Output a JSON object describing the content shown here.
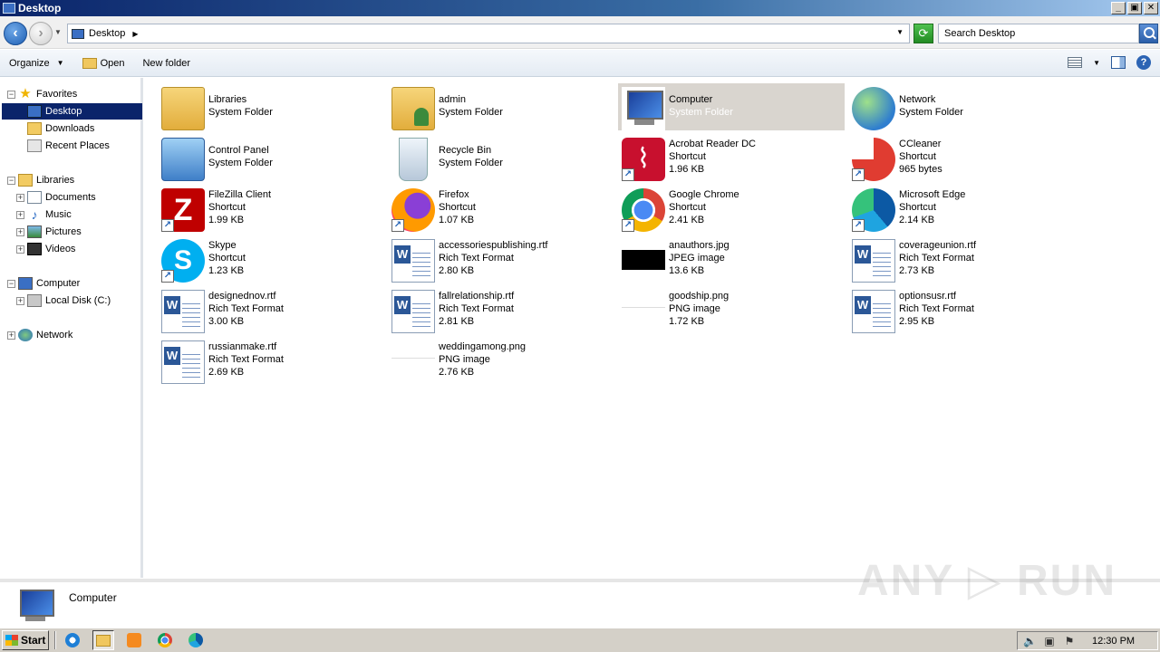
{
  "window": {
    "title": "Desktop",
    "controls": [
      "_",
      "▣",
      "✕"
    ]
  },
  "address": {
    "location": "Desktop",
    "search_placeholder": "Search Desktop"
  },
  "commands": {
    "organize": "Organize",
    "open": "Open",
    "new_folder": "New folder"
  },
  "nav": {
    "favorites": "Favorites",
    "desktop": "Desktop",
    "downloads": "Downloads",
    "recent_places": "Recent Places",
    "libraries": "Libraries",
    "documents": "Documents",
    "music": "Music",
    "pictures": "Pictures",
    "videos": "Videos",
    "computer": "Computer",
    "local_disk": "Local Disk (C:)",
    "network": "Network"
  },
  "items": [
    {
      "name": "Libraries",
      "type": "System Folder",
      "size": "",
      "icon": "libraries-icon"
    },
    {
      "name": "admin",
      "type": "System Folder",
      "size": "",
      "icon": "user-folder-icon"
    },
    {
      "name": "Computer",
      "type": "System Folder",
      "size": "",
      "icon": "computer-icon"
    },
    {
      "name": "Network",
      "type": "System Folder",
      "size": "",
      "icon": "network-icon"
    },
    {
      "name": "Control Panel",
      "type": "System Folder",
      "size": "",
      "icon": "control-panel-icon"
    },
    {
      "name": "Recycle Bin",
      "type": "System Folder",
      "size": "",
      "icon": "recycle-bin-icon"
    },
    {
      "name": "Acrobat Reader DC",
      "type": "Shortcut",
      "size": "1.96 KB",
      "icon": "acrobat-icon"
    },
    {
      "name": "CCleaner",
      "type": "Shortcut",
      "size": "965 bytes",
      "icon": "ccleaner-icon"
    },
    {
      "name": "FileZilla Client",
      "type": "Shortcut",
      "size": "1.99 KB",
      "icon": "filezilla-icon"
    },
    {
      "name": "Firefox",
      "type": "Shortcut",
      "size": "1.07 KB",
      "icon": "firefox-icon"
    },
    {
      "name": "Google Chrome",
      "type": "Shortcut",
      "size": "2.41 KB",
      "icon": "chrome-icon"
    },
    {
      "name": "Microsoft Edge",
      "type": "Shortcut",
      "size": "2.14 KB",
      "icon": "edge-icon"
    },
    {
      "name": "Skype",
      "type": "Shortcut",
      "size": "1.23 KB",
      "icon": "skype-icon"
    },
    {
      "name": "accessoriespublishing.rtf",
      "type": "Rich Text Format",
      "size": "2.80 KB",
      "icon": "rtf-file-icon"
    },
    {
      "name": "anauthors.jpg",
      "type": "JPEG image",
      "size": "13.6 KB",
      "icon": "jpg-thumbnail-icon"
    },
    {
      "name": "coverageunion.rtf",
      "type": "Rich Text Format",
      "size": "2.73 KB",
      "icon": "rtf-file-icon"
    },
    {
      "name": "designednov.rtf",
      "type": "Rich Text Format",
      "size": "3.00 KB",
      "icon": "rtf-file-icon"
    },
    {
      "name": "fallrelationship.rtf",
      "type": "Rich Text Format",
      "size": "2.81 KB",
      "icon": "rtf-file-icon"
    },
    {
      "name": "goodship.png",
      "type": "PNG image",
      "size": "1.72 KB",
      "icon": "png-thumbnail-icon"
    },
    {
      "name": "optionsusr.rtf",
      "type": "Rich Text Format",
      "size": "2.95 KB",
      "icon": "rtf-file-icon"
    },
    {
      "name": "russianmake.rtf",
      "type": "Rich Text Format",
      "size": "2.69 KB",
      "icon": "rtf-file-icon"
    },
    {
      "name": "weddingamong.png",
      "type": "PNG image",
      "size": "2.76 KB",
      "icon": "png-thumbnail-icon"
    }
  ],
  "details": {
    "selected_name": "Computer"
  },
  "watermark": "ANY ▷ RUN",
  "taskbar": {
    "start": "Start",
    "clock": "12:30 PM"
  }
}
